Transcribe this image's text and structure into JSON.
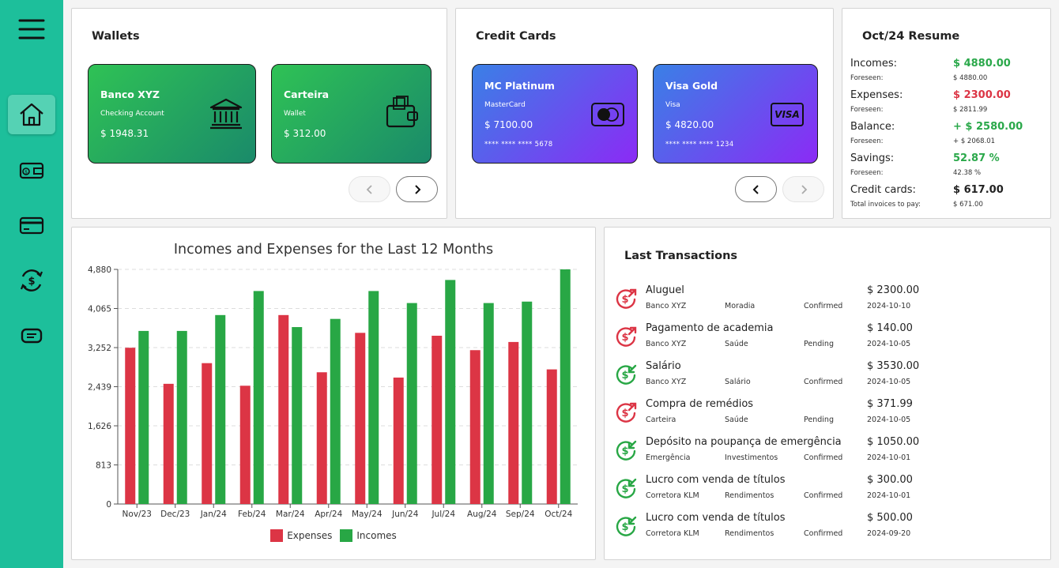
{
  "sidebar": {
    "items": [
      {
        "icon": "menu-icon"
      },
      {
        "icon": "home-icon",
        "active": true
      },
      {
        "icon": "wallet-icon"
      },
      {
        "icon": "credit-card-icon"
      },
      {
        "icon": "currency-exchange-icon"
      },
      {
        "icon": "receipt-icon"
      }
    ]
  },
  "wallets": {
    "title": "Wallets",
    "cards": [
      {
        "name": "Banco XYZ",
        "type": "Checking Account",
        "balance": "$ 1948.31",
        "icon": "bank-icon"
      },
      {
        "name": "Carteira",
        "type": "Wallet",
        "balance": "$ 312.00",
        "icon": "wallet-icon"
      }
    ]
  },
  "credit_cards": {
    "title": "Credit Cards",
    "cards": [
      {
        "name": "MC Platinum",
        "brand": "MasterCard",
        "limit": "$ 7100.00",
        "number": "**** **** **** 5678",
        "icon": "mastercard-icon"
      },
      {
        "name": "Visa Gold",
        "brand": "Visa",
        "limit": "$ 4820.00",
        "number": "**** **** **** 1234",
        "icon": "visa-icon",
        "logo_text": "VISA"
      }
    ]
  },
  "resume": {
    "title": "Oct/24 Resume",
    "rows": [
      {
        "label": "Incomes:",
        "value": "$ 4880.00",
        "color": "#2aa84a",
        "sub_label": "Foreseen:",
        "sub_value": "$ 4880.00"
      },
      {
        "label": "Expenses:",
        "value": "$ 2300.00",
        "color": "#dc3545",
        "sub_label": "Foreseen:",
        "sub_value": "$ 2811.99"
      },
      {
        "label": "Balance:",
        "value": "+ $ 2580.00",
        "color": "#2aa84a",
        "sub_label": "Foreseen:",
        "sub_value": "+  $ 2068.01"
      },
      {
        "label": "Savings:",
        "value": "52.87 %",
        "color": "#2aa84a",
        "sub_label": "Foreseen:",
        "sub_value": "42.38 %"
      },
      {
        "label": "Credit cards:",
        "value": "$ 617.00",
        "color": "#222222",
        "sub_label": "Total invoices to pay:",
        "sub_value": "$ 671.00"
      }
    ]
  },
  "chart_data": {
    "type": "bar",
    "title": "Incomes and Expenses for the Last 12 Months",
    "categories": [
      "Nov/23",
      "Dec/23",
      "Jan/24",
      "Feb/24",
      "Mar/24",
      "Apr/24",
      "May/24",
      "Jun/24",
      "Jul/24",
      "Aug/24",
      "Sep/24",
      "Oct/24"
    ],
    "series": [
      {
        "name": "Expenses",
        "color": "#dc3545",
        "values": [
          3250,
          2500,
          2930,
          2460,
          3930,
          2740,
          3560,
          2630,
          3500,
          3200,
          3370,
          2800
        ]
      },
      {
        "name": "Incomes",
        "color": "#28a745",
        "values": [
          3600,
          3600,
          3930,
          4430,
          3680,
          3850,
          4430,
          4180,
          4660,
          4180,
          4210,
          4880
        ]
      }
    ],
    "yticks": [
      "0",
      "813",
      "1,626",
      "2,439",
      "3,252",
      "4,065",
      "4,880"
    ],
    "ylim": [
      0,
      4880
    ],
    "grid": true,
    "legend_position": "bottom"
  },
  "transactions": {
    "title": "Last Transactions",
    "items": [
      {
        "kind": "expense",
        "name": "Aluguel",
        "account": "Banco XYZ",
        "category": "Moradia",
        "status": "Confirmed",
        "amount": "$ 2300.00",
        "date": "2024-10-10"
      },
      {
        "kind": "expense",
        "name": "Pagamento de academia",
        "account": "Banco XYZ",
        "category": "Saúde",
        "status": "Pending",
        "amount": "$ 140.00",
        "date": "2024-10-05"
      },
      {
        "kind": "income",
        "name": "Salário",
        "account": "Banco XYZ",
        "category": "Salário",
        "status": "Confirmed",
        "amount": "$ 3530.00",
        "date": "2024-10-05"
      },
      {
        "kind": "expense",
        "name": "Compra de remédios",
        "account": "Carteira",
        "category": "Saúde",
        "status": "Pending",
        "amount": "$ 371.99",
        "date": "2024-10-05"
      },
      {
        "kind": "income",
        "name": "Depósito na poupança de emergência",
        "account": "Emergência",
        "category": "Investimentos",
        "status": "Confirmed",
        "amount": "$ 1050.00",
        "date": "2024-10-01"
      },
      {
        "kind": "income",
        "name": "Lucro com venda de títulos",
        "account": "Corretora KLM",
        "category": "Rendimentos",
        "status": "Confirmed",
        "amount": "$ 300.00",
        "date": "2024-10-01"
      },
      {
        "kind": "income",
        "name": "Lucro com venda de títulos",
        "account": "Corretora KLM",
        "category": "Rendimentos",
        "status": "Confirmed",
        "amount": "$ 500.00",
        "date": "2024-09-20"
      }
    ]
  },
  "colors": {
    "sidebar": "#1dbf9b",
    "income": "#28a745",
    "expense": "#dc3545"
  }
}
